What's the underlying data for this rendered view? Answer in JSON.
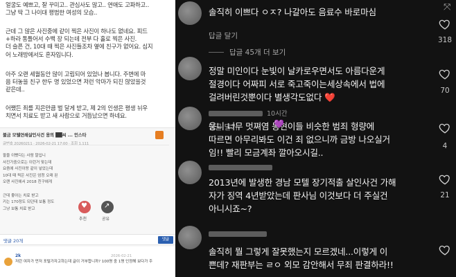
{
  "article": {
    "para1": "얼굴도 예쁘고, 잘 꾸미고.. 관심사도 많고.. 연애도 고파하고..\n그냥 딱 그 나이대 평범한 여성의 모습..",
    "para2": "근데 그 많은 사진중에 같이 찍은 사진이 하나도 없네요. 피드\n+하라 통틀어서 수백 장 되는데 전부 다 홀로 찍은 사진.\n더 슬픈 건, 10대 때 찍은 사진들조차 옆에 친구가 없어요. 심지\n어 노래방에서도 혼자입니다.",
    "para3": "아주 오랜 세월동안 많이 고립되어 있었나 봅니다. 주변에 마\n음 터놓을 친구 한두 명 있었으면 저런 악마가 되진 않았을것\n같은데..",
    "para4": "어쨌든 죄를 지은만큼 벌 달게 받고, 제 2의 인생은 평생 뉘우\n치면서 치료도 받고 새 사람으로 거듭났으면 하네요."
  },
  "card": {
    "title": "불금 모텔연쇄살인사건 용의 ██씨 ... 인스타",
    "meta": "글번호 20260211 · 2026-02-21 17:00 · 조회 1,111",
    "body": "팔을 이뻤다는 사람 말입니\n사진가중으로는 이런거 맞는데\n요즘에 사진이랑 같이 넣었는데\n10대 때 찍은 사진은 엄청 오래 된\n오랜 사진에서 2018 친구에게\n\n근데 좋아는 치료 받고\n키는 170정도 되던데 보통 정도\n그냥 보통 치료 받고",
    "like_label": "추천",
    "share_label": "공유",
    "comment_count": "댓글 20개",
    "comment_write": "댓글"
  },
  "reply": {
    "user": "2k",
    "date": "2026-02-21",
    "text": "저런 여자가 먼저 포털가자고하는데 글이 거부합니까? 100명 중 1명 인정해 보다가 주"
  },
  "comments": [
    {
      "text": "솔직히 이쁘다 ㅇㅈ? 나갈아도 음료수 바로마심",
      "reply_label": "답글 달기",
      "count": "318",
      "more": "답글 45개 더 보기"
    },
    {
      "text": "정말 미인이다 눈빛이 날카로우면서도 아름다운게\n절경이다   어짜피 서로 죽고죽이는세상속에서 법에\n걸려버린것뿐이다 별생각도없다 ",
      "heart_emoji": "❤️",
      "reply_label": "답글 달기",
      "count": "70"
    },
    {
      "time": "10시간",
      "text": "웅니 너무 멋쪄염  동현이들 비슷한 범죄 형량에\n따르면 아무리봐도 이건 죄 없으니까 금방 나오실거\n임!! 빨리 모금계좌 깔아오시길..",
      "emoji": "💜",
      "count": "4"
    },
    {
      "text": "2013년에 발생한 경남 모텔 장기적출 살인사건 가해\n자가 징역 4년받았는데 판사님 이것보다 더 주실건\n아니시죠~?",
      "count": "21"
    },
    {
      "text": "솔직히 뭘 그렇게 잘못했는지 모르겠네...이렇게 이\n쁜데? 재판부는 ㄹㅇ 외모 감안해서 무죄 판결하라!!"
    }
  ],
  "colors": {
    "dark_bg": "#121212",
    "like_red": "#d85b5b",
    "link_blue": "#2a58a8"
  }
}
